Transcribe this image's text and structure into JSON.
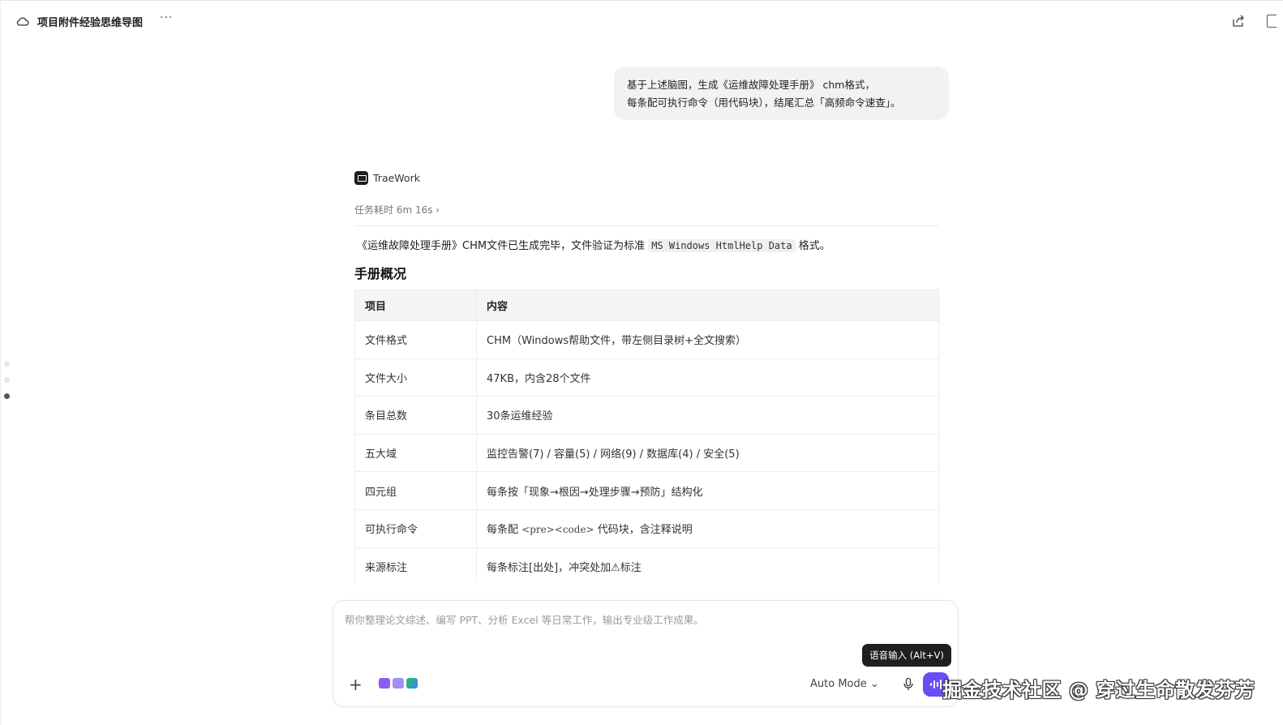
{
  "topbar": {
    "title": "项目附件经验思维导图",
    "more_label": "···"
  },
  "user_message": {
    "line1": "基于上述脑图，生成《运维故障处理手册》 chm格式，",
    "line2": "每条配可执行命令（用代码块），结尾汇总「高频命令速查」。"
  },
  "agent": {
    "name": "TraeWork",
    "task_time": "任务耗时 6m 16s ›",
    "result_before": "《运维故障处理手册》CHM文件已生成完毕，文件验证为标准 ",
    "result_code": "MS Windows HtmlHelp Data",
    "result_after": " 格式。",
    "section_title": "手册概况"
  },
  "table": {
    "headers": [
      "项目",
      "内容"
    ],
    "rows": [
      {
        "item": "文件格式",
        "content": "CHM（Windows帮助文件，带左侧目录树+全文搜索）"
      },
      {
        "item": "文件大小",
        "content": "47KB，内含28个文件"
      },
      {
        "item": "条目总数",
        "content": "30条运维经验"
      },
      {
        "item": "五大域",
        "content": "监控告警(7) / 容量(5) / 网络(9) / 数据库(4) / 安全(5)"
      },
      {
        "item": "四元组",
        "content": "每条按「现象→根因→处理步骤→预防」结构化"
      },
      {
        "item": "可执行命令",
        "content_before": "每条配 ",
        "content_code": "<pre><code>",
        "content_after": " 代码块，含注释说明"
      },
      {
        "item": "来源标注",
        "content": "每条标注[出处]，冲突处加⚠标注"
      }
    ]
  },
  "composer": {
    "placeholder": "帮你整理论文综述、编写 PPT、分析 Excel 等日常工作，输出专业级工作成果。",
    "mode_label": "Auto Mode ⌄",
    "tooltip": "语音输入 (Alt+V)"
  },
  "watermark": "掘金技术社区 @ 穿过生命散发芬芳",
  "colors": {
    "accent": "#6a4df4",
    "bubble": "#f2f2f3",
    "table_header": "#f5f5f5"
  }
}
